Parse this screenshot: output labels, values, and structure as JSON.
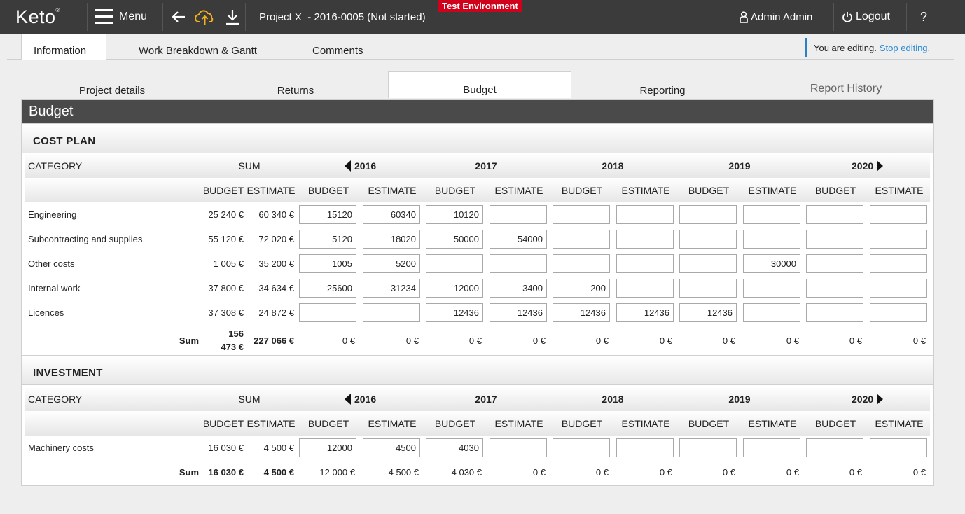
{
  "app": {
    "logo": "Keto",
    "logo_mark": "®",
    "menu_label": "Menu",
    "project_title": "Project X  - 2016-0005 (Not started)",
    "test_env": "Test Environment",
    "user": "Admin Admin",
    "logout": "Logout",
    "help": "?"
  },
  "main_tabs": [
    "Information",
    "Work Breakdown & Gantt",
    "Comments"
  ],
  "editing": {
    "text": "You are editing.",
    "link": "Stop editing."
  },
  "sub_tabs": [
    "Project details",
    "Returns",
    "Budget",
    "Reporting",
    "Report History"
  ],
  "panel_title": "Budget",
  "table_headers": {
    "category": "CATEGORY",
    "sum": "SUM",
    "years": [
      "2016",
      "2017",
      "2018",
      "2019",
      "2020"
    ],
    "budget": "BUDGET",
    "estimate": "ESTIMATE",
    "sum_label": "Sum"
  },
  "cost_plan": {
    "title": "COST PLAN",
    "rows": [
      {
        "label": "Engineering",
        "budget": "25 240 €",
        "estimate": "60 340 €",
        "cells": [
          "15120",
          "60340",
          "10120",
          "",
          "",
          "",
          "",
          "",
          "",
          ""
        ]
      },
      {
        "label": "Subcontracting and supplies",
        "budget": "55 120 €",
        "estimate": "72 020 €",
        "cells": [
          "5120",
          "18020",
          "50000",
          "54000",
          "",
          "",
          "",
          "",
          "",
          ""
        ]
      },
      {
        "label": "Other costs",
        "budget": "1 005 €",
        "estimate": "35 200 €",
        "cells": [
          "1005",
          "5200",
          "",
          "",
          "",
          "",
          "",
          "30000",
          "",
          ""
        ]
      },
      {
        "label": "Internal work",
        "budget": "37 800 €",
        "estimate": "34 634 €",
        "cells": [
          "25600",
          "31234",
          "12000",
          "3400",
          "200",
          "",
          "",
          "",
          "",
          ""
        ]
      },
      {
        "label": "Licences",
        "budget": "37 308 €",
        "estimate": "24 872 €",
        "cells": [
          "",
          "",
          "12436",
          "12436",
          "12436",
          "12436",
          "12436",
          "",
          "",
          ""
        ]
      }
    ],
    "sum_budget_line1": "156",
    "sum_budget_line2": "473 €",
    "sum_estimate": "227 066 €",
    "sums": [
      "0 €",
      "0 €",
      "0 €",
      "0 €",
      "0 €",
      "0 €",
      "0 €",
      "0 €",
      "0 €",
      "0 €"
    ]
  },
  "investment": {
    "title": "INVESTMENT",
    "rows": [
      {
        "label": "Machinery costs",
        "budget": "16 030 €",
        "estimate": "4 500 €",
        "cells": [
          "12000",
          "4500",
          "4030",
          "",
          "",
          "",
          "",
          "",
          "",
          ""
        ]
      }
    ],
    "sum_budget": "16 030 €",
    "sum_estimate": "4 500 €",
    "sums": [
      "12 000 €",
      "4 500 €",
      "4 030 €",
      "0 €",
      "0 €",
      "0 €",
      "0 €",
      "0 €",
      "0 €",
      "0 €"
    ]
  }
}
